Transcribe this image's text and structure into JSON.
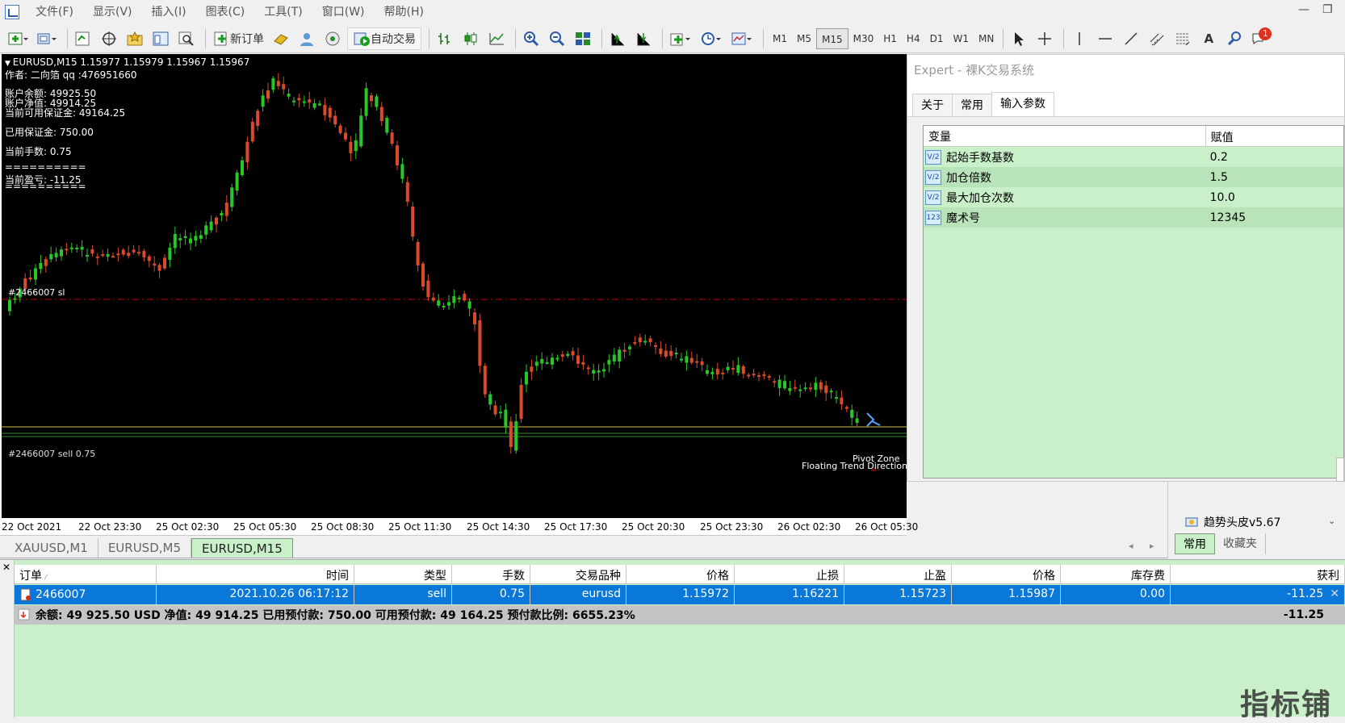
{
  "menu": [
    "文件(F)",
    "显示(V)",
    "插入(I)",
    "图表(C)",
    "工具(T)",
    "窗口(W)",
    "帮助(H)"
  ],
  "toolbar": {
    "new_order": "新订单",
    "auto_trade": "自动交易",
    "timeframes": [
      "M1",
      "M5",
      "M15",
      "M30",
      "H1",
      "H4",
      "D1",
      "W1",
      "MN"
    ],
    "active_timeframe": "M15",
    "notification_count": "1",
    "text_tool": "A"
  },
  "chart": {
    "symbol_line": "EURUSD,M15  1.15977 1.15979 1.15967 1.15967",
    "author": "作者: 二向箔 qq :476951660",
    "info_lines": [
      "账户余额: 49925.50",
      "账户净值: 49914.25",
      "当前可用保证金: 49164.25",
      "已用保证金: 750.00",
      "当前手数: 0.75",
      "==========",
      "当前盈亏: -11.25",
      "=========="
    ],
    "sl_label": "#2466007 sl",
    "order_label": "#2466007 sell 0.75",
    "pivot_label": "Pivot Zone",
    "trend_label": "Floating Trend Direction",
    "x_labels": [
      "22 Oct 2021",
      "22 Oct 23:30",
      "25 Oct 02:30",
      "25 Oct 05:30",
      "25 Oct 08:30",
      "25 Oct 11:30",
      "25 Oct 14:30",
      "25 Oct 17:30",
      "25 Oct 20:30",
      "25 Oct 23:30",
      "26 Oct 02:30",
      "26 Oct 05:30"
    ],
    "colors": {
      "up": "#26c726",
      "down": "#d94a2e",
      "sl_line": "#c00000",
      "order_line": "#d4c04a",
      "green_line": "#3c8c3c"
    }
  },
  "chart_tabs": [
    "XAUUSD,M1",
    "EURUSD,M5",
    "EURUSD,M15"
  ],
  "active_chart_tab": "EURUSD,M15",
  "expert": {
    "title": "Expert - 裸K交易系统",
    "tabs": [
      "关于",
      "常用",
      "输入参数"
    ],
    "active_tab": "输入参数",
    "columns": [
      "变量",
      "赋值"
    ],
    "params": [
      {
        "icon": "V/2",
        "name": "起始手数基数",
        "value": "0.2"
      },
      {
        "icon": "V/2",
        "name": "加仓倍数",
        "value": "1.5"
      },
      {
        "icon": "V/2",
        "name": "最大加仓次数",
        "value": "10.0"
      },
      {
        "icon": "123",
        "name": "魔术号",
        "value": "12345"
      }
    ]
  },
  "navigator": {
    "item": "趋势头皮v5.67",
    "tabs": [
      "常用",
      "收藏夹"
    ]
  },
  "terminal": {
    "columns": [
      "订单",
      "时间",
      "类型",
      "手数",
      "交易品种",
      "价格",
      "止损",
      "止盈",
      "价格",
      "库存费",
      "获利"
    ],
    "order": {
      "id": "2466007",
      "time": "2021.10.26 06:17:12",
      "type": "sell",
      "lots": "0.75",
      "symbol": "eurusd",
      "open_price": "1.15972",
      "sl": "1.16221",
      "tp": "1.15723",
      "price": "1.15987",
      "swap": "0.00",
      "profit": "-11.25"
    },
    "balance_line": "余额: 49 925.50 USD  净值: 49 914.25  已用预付款: 750.00  可用预付款: 49 164.25  预付款比例: 6655.23%",
    "balance_profit": "-11.25"
  },
  "watermark": "指标铺"
}
